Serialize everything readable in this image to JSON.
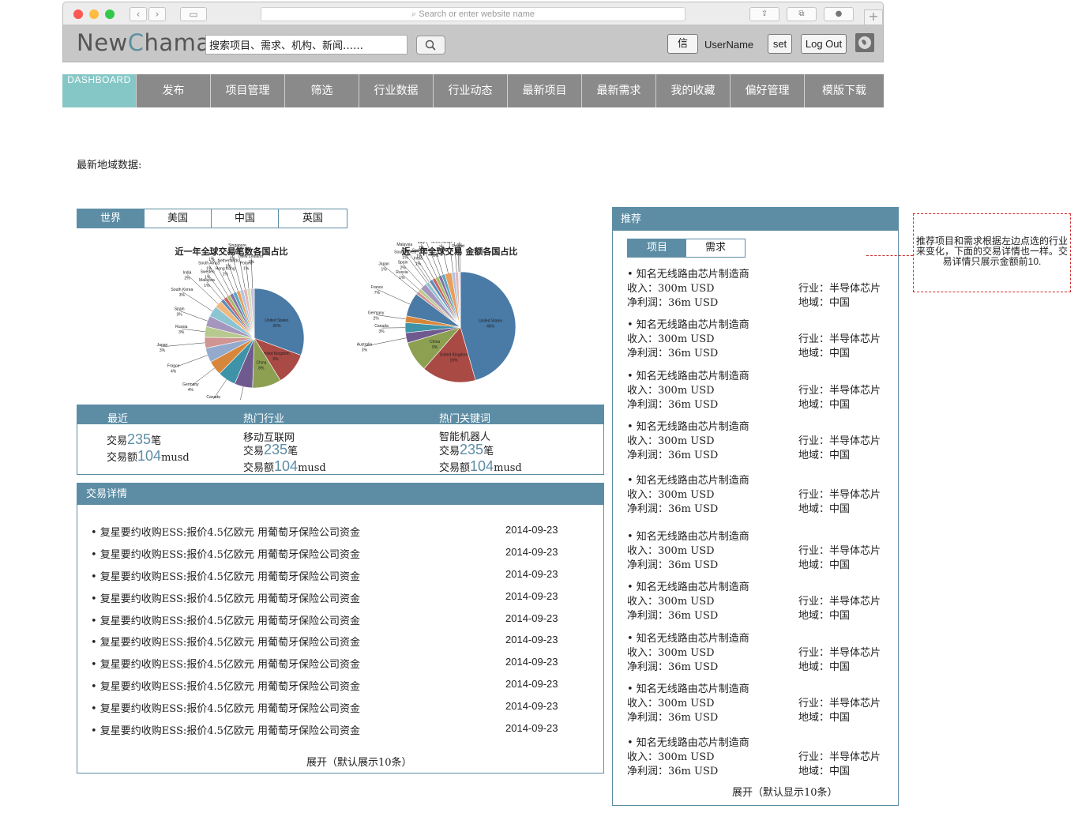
{
  "browser": {
    "url_placeholder": "Search or enter website name"
  },
  "header": {
    "logo": {
      "part1": "New",
      "part2": "C",
      "part3": "hama"
    },
    "search_value": "搜索项目、需求、机构、新闻……",
    "msg_label": "信",
    "username": "UserName",
    "set_label": "set",
    "logout_label": "Log Out"
  },
  "nav": [
    "DASHBOARD",
    "发布",
    "项目管理",
    "筛选",
    "行业数据",
    "行业动态",
    "最新项目",
    "最新需求",
    "我的收藏",
    "偏好管理",
    "模版下载"
  ],
  "geo": {
    "title": "最新地域数据:",
    "tabs": [
      "世界",
      "美国",
      "中国",
      "英国"
    ]
  },
  "chart_data": [
    {
      "type": "pie",
      "title": "近一年全球交易笔数各国占比",
      "slices": [
        {
          "label": "United States",
          "value": 26,
          "color": "#4a7aa6"
        },
        {
          "label": "United Kingdom",
          "value": 9,
          "color": "#a94a45"
        },
        {
          "label": "China",
          "value": 8,
          "color": "#8da052"
        },
        {
          "label": "Australia",
          "value": 5,
          "color": "#6f5a8f"
        },
        {
          "label": "Canada",
          "value": 5,
          "color": "#3f93a8"
        },
        {
          "label": "Germany",
          "value": 4,
          "color": "#d7873b"
        },
        {
          "label": "France",
          "value": 4,
          "color": "#93aacd"
        },
        {
          "label": "Japan",
          "value": 3,
          "color": "#d09492"
        },
        {
          "label": "Russia",
          "value": 3,
          "color": "#b8c990"
        },
        {
          "label": "Spain",
          "value": 3,
          "color": "#a496bd"
        },
        {
          "label": "South Korea",
          "value": 3,
          "color": "#8cc4d2"
        },
        {
          "label": "India",
          "value": 2,
          "color": "#f2b77c"
        },
        {
          "label": "Malaysia",
          "value": 1,
          "color": "#5d8abb"
        },
        {
          "label": "Sweden",
          "value": 1,
          "color": "#c56562"
        },
        {
          "label": "South Africa",
          "value": 1,
          "color": "#a5ba6a"
        },
        {
          "label": "Italy",
          "value": 1,
          "color": "#8672a6"
        },
        {
          "label": "Hong Kong",
          "value": 1,
          "color": "#5aa9c0"
        },
        {
          "label": "Netherlands",
          "value": 1,
          "color": "#e8a05e"
        },
        {
          "label": "Brazil",
          "value": 1,
          "color": "#b3c3df"
        },
        {
          "label": "Singapore",
          "value": 1,
          "color": "#e3b8b7"
        },
        {
          "label": "Poland",
          "value": 1,
          "color": "#d5e0bd"
        },
        {
          "label": "New Zealand",
          "value": 1,
          "color": "#c9c1dc"
        }
      ]
    },
    {
      "type": "pie",
      "title": "近一年全球交易 金额各国占比",
      "slices": [
        {
          "label": "United States",
          "value": 46,
          "color": "#4a7aa6"
        },
        {
          "label": "United Kingdom",
          "value": 16,
          "color": "#a94a45"
        },
        {
          "label": "China",
          "value": 9,
          "color": "#8da052"
        },
        {
          "label": "Australia",
          "value": 3,
          "color": "#6f5a8f"
        },
        {
          "label": "Canada",
          "value": 3,
          "color": "#3f93a8"
        },
        {
          "label": "Germany",
          "value": 2,
          "color": "#d7873b"
        },
        {
          "label": "France",
          "value": 7,
          "color": "#4a7aa6"
        },
        {
          "label": "Japan",
          "value": 1,
          "color": "#d09492"
        },
        {
          "label": "Russia",
          "value": 1,
          "color": "#b8c990"
        },
        {
          "label": "Spain",
          "value": 2,
          "color": "#a496bd"
        },
        {
          "label": "South Korea",
          "value": 1,
          "color": "#8cc4d2"
        },
        {
          "label": "Malaysia",
          "value": 0,
          "color": "#f2b77c"
        },
        {
          "label": "India",
          "value": 1,
          "color": "#5d8abb"
        },
        {
          "label": "Sweden",
          "value": 1,
          "color": "#c56562"
        },
        {
          "label": "Italy",
          "value": 1,
          "color": "#a5ba6a"
        },
        {
          "label": "Hong Kong",
          "value": 1,
          "color": "#8672a6"
        },
        {
          "label": "South Africa",
          "value": 1,
          "color": "#5aa9c0"
        },
        {
          "label": "Netherlands",
          "value": 2,
          "color": "#e8a05e"
        },
        {
          "label": "Brazil",
          "value": 1,
          "color": "#b3c3df"
        },
        {
          "label": "Singapore",
          "value": 1,
          "color": "#e3b8b7"
        },
        {
          "label": "Poland",
          "value": 0,
          "color": "#d5e0bd"
        },
        {
          "label": "New Zealand",
          "value": 0,
          "color": "#c9c1dc"
        }
      ]
    }
  ],
  "stats": {
    "headers": [
      "最近",
      "热门行业",
      "热门关键词"
    ],
    "recent": {
      "count_prefix": "交易",
      "count": "235",
      "count_unit": "笔",
      "amount_prefix": "交易额",
      "amount": "104",
      "amount_unit": "musd"
    },
    "industry": {
      "name": "移动互联网",
      "count_prefix": "交易",
      "count": "235",
      "count_unit": "笔",
      "amount_prefix": "交易额",
      "amount": "104",
      "amount_unit": "musd"
    },
    "keyword": {
      "name": "智能机器人",
      "count_prefix": "交易",
      "count": "235",
      "count_unit": "笔",
      "amount_prefix": "交易额",
      "amount": "104",
      "amount_unit": "musd"
    }
  },
  "deals": {
    "title": "交易详情",
    "items": [
      {
        "text": "• 复星要约收购ESS:报价4.5亿欧元 用葡萄牙保险公司资金",
        "date": "2014-09-23"
      },
      {
        "text": "• 复星要约收购ESS:报价4.5亿欧元 用葡萄牙保险公司资金",
        "date": "2014-09-23"
      },
      {
        "text": "• 复星要约收购ESS:报价4.5亿欧元 用葡萄牙保险公司资金",
        "date": "2014-09-23"
      },
      {
        "text": "• 复星要约收购ESS:报价4.5亿欧元 用葡萄牙保险公司资金",
        "date": "2014-09-23"
      },
      {
        "text": "• 复星要约收购ESS:报价4.5亿欧元 用葡萄牙保险公司资金",
        "date": "2014-09-23"
      },
      {
        "text": "• 复星要约收购ESS:报价4.5亿欧元 用葡萄牙保险公司资金",
        "date": "2014-09-23"
      },
      {
        "text": "• 复星要约收购ESS:报价4.5亿欧元 用葡萄牙保险公司资金",
        "date": "2014-09-23"
      },
      {
        "text": "• 复星要约收购ESS:报价4.5亿欧元 用葡萄牙保险公司资金",
        "date": "2014-09-23"
      },
      {
        "text": "• 复星要约收购ESS:报价4.5亿欧元 用葡萄牙保险公司资金",
        "date": "2014-09-23"
      },
      {
        "text": "• 复星要约收购ESS:报价4.5亿欧元 用葡萄牙保险公司资金",
        "date": "2014-09-23"
      }
    ],
    "expand": "展开（默认展示10条）"
  },
  "recommend": {
    "title": "推荐",
    "tabs": [
      "项目",
      "需求"
    ],
    "items": [
      {
        "title": "• 知名无线路由芯片制造商",
        "revenue": "收入：300m USD",
        "profit": "净利润：36m USD",
        "industry": "行业：半导体芯片",
        "region": "地域：中国"
      },
      {
        "title": "• 知名无线路由芯片制造商",
        "revenue": "收入：300m USD",
        "profit": "净利润：36m USD",
        "industry": "行业：半导体芯片",
        "region": "地域：中国"
      },
      {
        "title": "• 知名无线路由芯片制造商",
        "revenue": "收入：300m USD",
        "profit": "净利润：36m USD",
        "industry": "行业：半导体芯片",
        "region": "地域：中国"
      },
      {
        "title": "• 知名无线路由芯片制造商",
        "revenue": "收入：300m USD",
        "profit": "净利润：36m USD",
        "industry": "行业：半导体芯片",
        "region": "地域：中国"
      },
      {
        "title": "• 知名无线路由芯片制造商",
        "revenue": "收入：300m USD",
        "profit": "净利润：36m USD",
        "industry": "行业：半导体芯片",
        "region": "地域：中国"
      },
      {
        "title": "• 知名无线路由芯片制造商",
        "revenue": "收入：300m USD",
        "profit": "净利润：36m USD",
        "industry": "行业：半导体芯片",
        "region": "地域：中国"
      },
      {
        "title": "• 知名无线路由芯片制造商",
        "revenue": "收入：300m USD",
        "profit": "净利润：36m USD",
        "industry": "行业：半导体芯片",
        "region": "地域：中国"
      },
      {
        "title": "• 知名无线路由芯片制造商",
        "revenue": "收入：300m USD",
        "profit": "净利润：36m USD",
        "industry": "行业：半导体芯片",
        "region": "地域：中国"
      },
      {
        "title": "• 知名无线路由芯片制造商",
        "revenue": "收入：300m USD",
        "profit": "净利润：36m USD",
        "industry": "行业：半导体芯片",
        "region": "地域：中国"
      },
      {
        "title": "• 知名无线路由芯片制造商",
        "revenue": "收入：300m USD",
        "profit": "净利润：36m USD",
        "industry": "行业：半导体芯片",
        "region": "地域：中国"
      }
    ],
    "expand": "展开（默认显示10条）"
  },
  "note": "推荐项目和需求根据左边点选的行业来变化，下面的交易详情也一样。交易详情只展示金额前10."
}
